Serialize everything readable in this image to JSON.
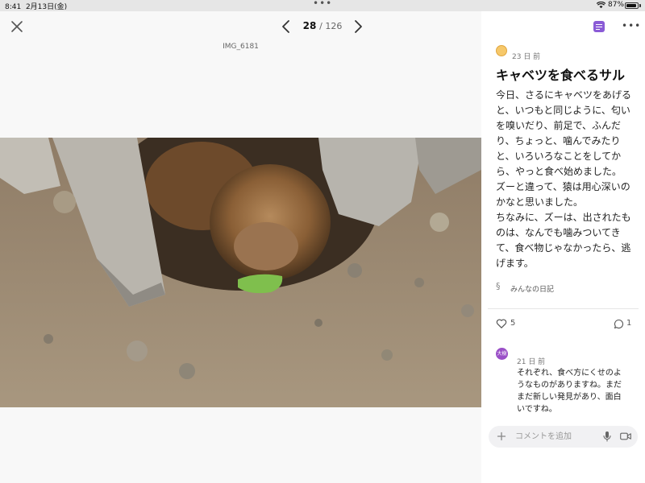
{
  "status_bar": {
    "time": "8:41",
    "date": "2月13日(金)",
    "battery": "87%"
  },
  "viewer": {
    "current_index": "28",
    "total": "/ 126",
    "filename": "IMG_6181"
  },
  "post": {
    "time_ago": "23 日 前",
    "title": "キャベツを食べるサル",
    "body": [
      "今日、さるにキャベツをあげると、いつもと同じように、匂いを嗅いだり、前足で、ふんだり、ちょっと、噛んでみたりと、いろいろなことをしてから、やっと食べ始めました。",
      "ズーと違って、猿は用心深いのかなと思いました。",
      "ちなみに、ズーは、出されたものは、なんでも噛みついてきて、食べ物じゃなかったら、逃げます。"
    ],
    "tag": "みんなの日記",
    "likes": "5",
    "comments_count": "1"
  },
  "comment": {
    "avatar_text": "大樹",
    "time_ago": "21 日 前",
    "text": "それぞれ、食べ方にくせのようなものがありますね。まだまだ新しい発見があり、面白いですね。"
  },
  "comment_input": {
    "placeholder": "コメントを追加"
  },
  "icons": {
    "close": "close-icon",
    "prev": "chevron-left-icon",
    "next": "chevron-right-icon",
    "diary": "diary-icon",
    "more": "more-icon",
    "like": "heart-icon",
    "comment": "comment-icon",
    "plus": "plus-icon",
    "mic": "mic-icon",
    "video": "video-icon"
  },
  "colors": {
    "accent": "#8a5bd6",
    "comment_avatar": "#9a4fc7"
  }
}
